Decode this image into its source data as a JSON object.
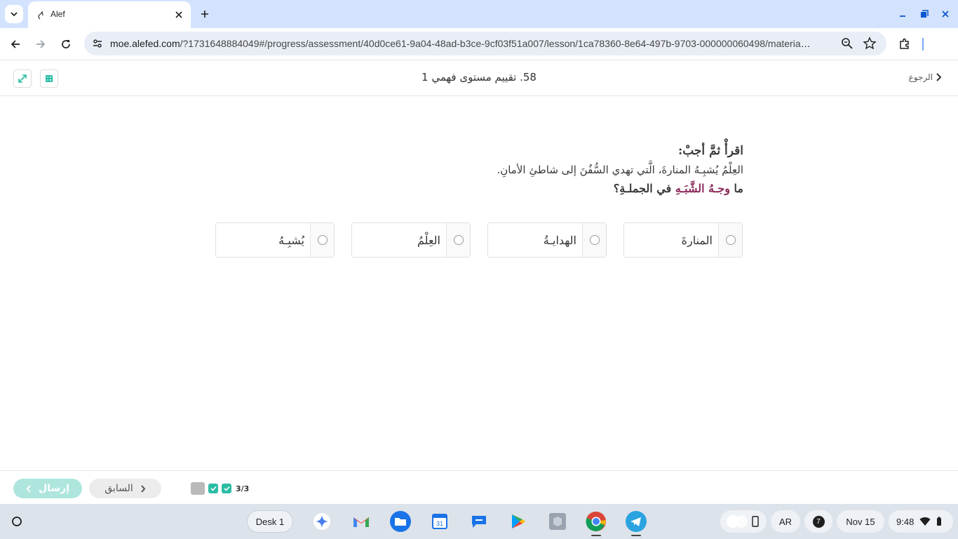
{
  "browser": {
    "tab_title": "Alef",
    "url_host": "moe.alefed.com",
    "url_path": "/?1731648884049#/progress/assessment/40d0ce61-9a04-48ad-b3ce-9cf03f51a007/lesson/1ca78360-8e64-497b-9703-000000060498/material/..."
  },
  "header": {
    "title": "58. تقييم مستوى فهمي 1",
    "back_label": "الرجوع"
  },
  "question": {
    "instruction": "اقرأْ ثمَّ أجبْ:",
    "sentence": "العِلْمُ يُشبِـهُ المنارةَ، الَّتي تهدي السُّفُنَ إلى شاطئِ الأمانِ.",
    "prompt_before": "ما ",
    "prompt_highlight": "وجـهُ الشَّبَـهِ",
    "prompt_after": " في الجملـةِ؟",
    "options": [
      {
        "label": "المنارةَ"
      },
      {
        "label": "الهدايـةُ"
      },
      {
        "label": "العِلْمُ"
      },
      {
        "label": "يُشبِـهُ"
      }
    ]
  },
  "footer": {
    "submit_label": "إرسال",
    "prev_label": "السابق",
    "progress_count": "3/3"
  },
  "shelf": {
    "desk_label": "Desk 1",
    "ime": "AR",
    "notification_count": "7",
    "date": "Nov 15",
    "time": "9:48"
  },
  "colors": {
    "accent": "#2cbca5",
    "submit_disabled": "#aee6dd",
    "highlight": "#8b2c5c"
  }
}
